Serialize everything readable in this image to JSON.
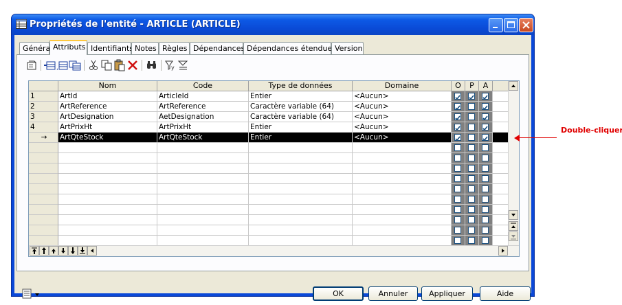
{
  "window": {
    "title": "Propriétés de l'entité - ARTICLE (ARTICLE)"
  },
  "tabs": [
    {
      "label": "Général"
    },
    {
      "label": "Attributs"
    },
    {
      "label": "Identifiants"
    },
    {
      "label": "Notes"
    },
    {
      "label": "Règles"
    },
    {
      "label": "Dépendances"
    },
    {
      "label": "Dépendances étendues"
    },
    {
      "label": "Version"
    }
  ],
  "grid": {
    "headers": {
      "nom": "Nom",
      "code": "Code",
      "type": "Type de données",
      "domaine": "Domaine",
      "o": "O",
      "p": "P",
      "a": "A"
    },
    "rows": [
      {
        "num": "1",
        "nom": "ArtId",
        "code": "ArticleId",
        "type": "Entier",
        "domaine": "<Aucun>",
        "o": true,
        "p": true,
        "a": true
      },
      {
        "num": "2",
        "nom": "ArtReference",
        "code": "ArtReference",
        "type": "Caractère variable (64)",
        "domaine": "<Aucun>",
        "o": true,
        "p": false,
        "a": true
      },
      {
        "num": "3",
        "nom": "ArtDesignation",
        "code": "AetDesignation",
        "type": "Caractère variable (64)",
        "domaine": "<Aucun>",
        "o": true,
        "p": false,
        "a": true
      },
      {
        "num": "4",
        "nom": "ArtPrixHt",
        "code": "ArtPrixHt",
        "type": "Entier",
        "domaine": "<Aucun>",
        "o": true,
        "p": false,
        "a": true
      },
      {
        "num": "→",
        "nom": "ArtQteStock",
        "code": "ArtQteStock",
        "type": "Entier",
        "domaine": "<Aucun>",
        "o": true,
        "p": false,
        "a": true
      }
    ]
  },
  "buttons": {
    "ok": "OK",
    "cancel": "Annuler",
    "apply": "Appliquer",
    "help": "Aide"
  },
  "annotation": {
    "text": "Double-cliquer"
  },
  "colors": {
    "titlebar": "#0a4ad6",
    "dialog_bg": "#ece9d8",
    "selected_row": "#000000",
    "annotation": "#e00000"
  }
}
